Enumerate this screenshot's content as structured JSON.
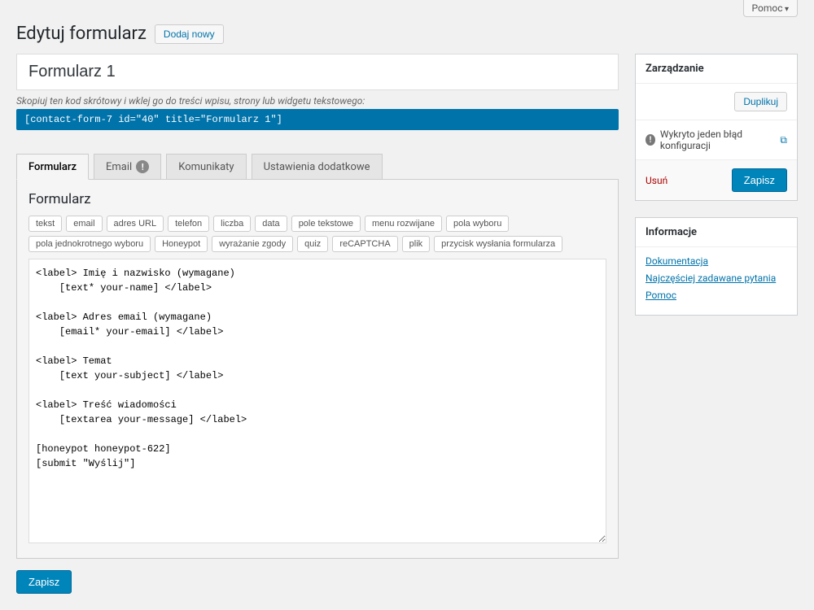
{
  "topbar": {
    "help": "Pomoc"
  },
  "header": {
    "title": "Edytuj formularz",
    "add_new": "Dodaj nowy"
  },
  "form_title": "Formularz 1",
  "shortcode": {
    "label": "Skopiuj ten kod skrótowy i wklej go do treści wpisu, strony lub widgetu tekstowego:",
    "code": "[contact-form-7 id=\"40\" title=\"Formularz 1\"]"
  },
  "tabs": {
    "form": "Formularz",
    "email": "Email",
    "messages": "Komunikaty",
    "additional": "Ustawienia dodatkowe"
  },
  "panel": {
    "heading": "Formularz"
  },
  "tag_buttons": [
    "tekst",
    "email",
    "adres URL",
    "telefon",
    "liczba",
    "data",
    "pole tekstowe",
    "menu rozwijane",
    "pola wyboru",
    "pola jednokrotnego wyboru",
    "Honeypot",
    "wyrażanie zgody",
    "quiz",
    "reCAPTCHA",
    "plik",
    "przycisk wysłania formularza"
  ],
  "editor_content": "<label> Imię i nazwisko (wymagane)\n    [text* your-name] </label>\n\n<label> Adres email (wymagane)\n    [email* your-email] </label>\n\n<label> Temat\n    [text your-subject] </label>\n\n<label> Treść wiadomości\n    [textarea your-message] </label>\n\n[honeypot honeypot-622]\n[submit \"Wyślij\"]",
  "save_label": "Zapisz",
  "sidebar": {
    "manage": {
      "heading": "Zarządzanie",
      "duplicate": "Duplikuj",
      "config_error": "Wykryto jeden błąd konfiguracji",
      "delete": "Usuń",
      "save": "Zapisz"
    },
    "info": {
      "heading": "Informacje",
      "links": [
        "Dokumentacja",
        "Najczęściej zadawane pytania",
        "Pomoc"
      ]
    }
  }
}
